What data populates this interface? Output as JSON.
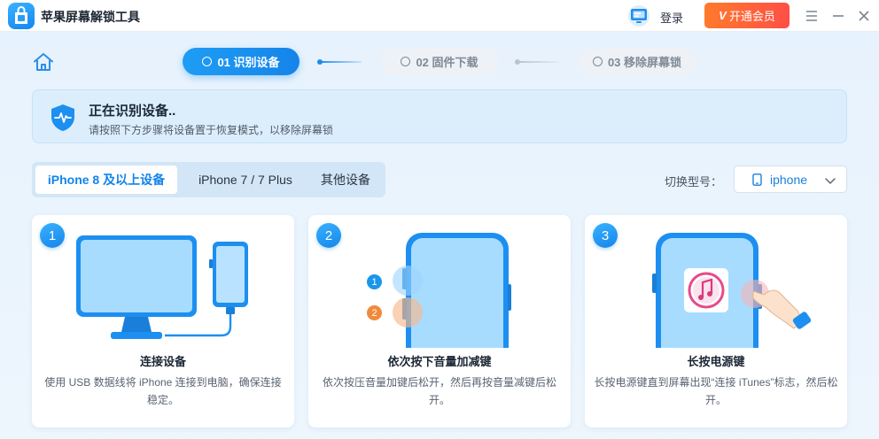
{
  "app": {
    "title": "苹果屏幕解锁工具"
  },
  "header": {
    "login_label": "登录",
    "vip_label": "开通会员",
    "vip_mark": "V"
  },
  "steps": [
    {
      "label": "01 识别设备",
      "state": "active"
    },
    {
      "label": "02 固件下载",
      "state": "inactive"
    },
    {
      "label": "03 移除屏幕锁",
      "state": "inactive"
    }
  ],
  "banner": {
    "title": "正在识别设备..",
    "subtitle": "请按照下方步骤将设备置于恢复模式，以移除屏幕锁"
  },
  "tabs": [
    {
      "label": "iPhone 8 及以上设备",
      "active": true
    },
    {
      "label": "iPhone 7 / 7 Plus",
      "active": false
    },
    {
      "label": "其他设备",
      "active": false
    }
  ],
  "model": {
    "label": "切换型号：",
    "value": "iphone"
  },
  "cards": [
    {
      "number": "1",
      "title": "连接设备",
      "description": "使用 USB 数据线将 iPhone 连接到电脑，确保连接稳定。"
    },
    {
      "number": "2",
      "title": "依次按下音量加减键",
      "description": "依次按压音量加键后松开，然后再按音量减键后松开。",
      "markers": [
        "1",
        "2"
      ]
    },
    {
      "number": "3",
      "title": "长按电源键",
      "description": "长按电源键直到屏幕出现“连接 iTunes”标志，然后松开。"
    }
  ],
  "colors": {
    "accent": "#1585ea",
    "vip_start": "#ff7a2c",
    "vip_end": "#ff4f45",
    "marker_blue": "#1a96ea",
    "marker_orange": "#f08a3c"
  }
}
